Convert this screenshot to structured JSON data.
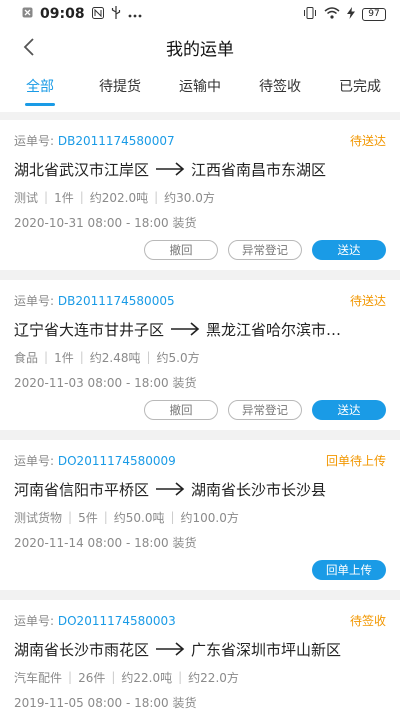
{
  "status_bar": {
    "time": "09:08",
    "battery": "97"
  },
  "header": {
    "title": "我的运单"
  },
  "tabs": [
    {
      "label": "全部",
      "active": true
    },
    {
      "label": "待提货",
      "active": false
    },
    {
      "label": "运输中",
      "active": false
    },
    {
      "label": "待签收",
      "active": false
    },
    {
      "label": "已完成",
      "active": false
    }
  ],
  "waybill_label": "运单号:",
  "orders": [
    {
      "number": "DB2011174580007",
      "status": "待送达",
      "from": "湖北省武汉市江岸区",
      "to": "江西省南昌市东湖区",
      "goods": "测试",
      "count": "1件",
      "weight": "约202.0吨",
      "volume": "约30.0方",
      "date": "2020-10-31 08:00 - 18:00 装货",
      "actions": [
        "撤回",
        "异常登记",
        "送达"
      ]
    },
    {
      "number": "DB2011174580005",
      "status": "待送达",
      "from": "辽宁省大连市甘井子区",
      "to": "黑龙江省哈尔滨市…",
      "goods": "食品",
      "count": "1件",
      "weight": "约2.48吨",
      "volume": "约5.0方",
      "date": "2020-11-03 08:00 - 18:00 装货",
      "actions": [
        "撤回",
        "异常登记",
        "送达"
      ]
    },
    {
      "number": "DO2011174580009",
      "status": "回单待上传",
      "from": "河南省信阳市平桥区",
      "to": "湖南省长沙市长沙县",
      "goods": "测试货物",
      "count": "5件",
      "weight": "约50.0吨",
      "volume": "约100.0方",
      "date": "2020-11-14 08:00 - 18:00 装货",
      "actions": [
        "回单上传"
      ]
    },
    {
      "number": "DO2011174580003",
      "status": "待签收",
      "from": "湖南省长沙市雨花区",
      "to": "广东省深圳市坪山新区",
      "goods": "汽车配件",
      "count": "26件",
      "weight": "约22.0吨",
      "volume": "约22.0方",
      "date": "2019-11-05 08:00 - 18:00 装货",
      "actions": []
    }
  ],
  "colors": {
    "accent": "#1a9be6",
    "status": "#f29700",
    "muted": "#8a8a8a"
  }
}
